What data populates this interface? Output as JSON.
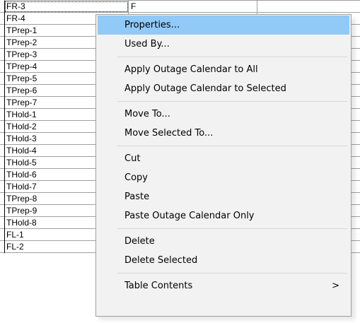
{
  "grid": {
    "rows": [
      {
        "name": "FR-3",
        "col2": "F",
        "selected": true
      },
      {
        "name": "FR-4",
        "col2": ""
      },
      {
        "name": "TPrep-1",
        "col2": ""
      },
      {
        "name": "TPrep-2",
        "col2": ""
      },
      {
        "name": "TPrep-3",
        "col2": ""
      },
      {
        "name": "TPrep-4",
        "col2": ""
      },
      {
        "name": "TPrep-5",
        "col2": ""
      },
      {
        "name": "TPrep-6",
        "col2": ""
      },
      {
        "name": "TPrep-7",
        "col2": ""
      },
      {
        "name": "THold-1",
        "col2": ""
      },
      {
        "name": "THold-2",
        "col2": ""
      },
      {
        "name": "THold-3",
        "col2": ""
      },
      {
        "name": "THold-4",
        "col2": ""
      },
      {
        "name": "THold-5",
        "col2": ""
      },
      {
        "name": "THold-6",
        "col2": ""
      },
      {
        "name": "THold-7",
        "col2": ""
      },
      {
        "name": "TPrep-8",
        "col2": ""
      },
      {
        "name": "TPrep-9",
        "col2": ""
      },
      {
        "name": "THold-8",
        "col2": ""
      },
      {
        "name": "FL-1",
        "col2": ""
      },
      {
        "name": "FL-2",
        "col2": ""
      }
    ]
  },
  "context_menu": {
    "items": [
      {
        "label": "Properties...",
        "highlighted": true
      },
      {
        "label": "Used By..."
      },
      {
        "separator": true
      },
      {
        "label": "Apply Outage Calendar to All"
      },
      {
        "label": "Apply Outage Calendar to Selected"
      },
      {
        "separator": true
      },
      {
        "label": "Move To..."
      },
      {
        "label": "Move Selected To..."
      },
      {
        "separator": true
      },
      {
        "label": "Cut"
      },
      {
        "label": "Copy"
      },
      {
        "label": "Paste"
      },
      {
        "label": "Paste Outage Calendar Only"
      },
      {
        "separator": true
      },
      {
        "label": "Delete"
      },
      {
        "label": "Delete Selected"
      },
      {
        "separator": true
      },
      {
        "label": "Table Contents",
        "submenu": true,
        "arrow": ">"
      }
    ],
    "highlight_color": "#91c9f7"
  }
}
